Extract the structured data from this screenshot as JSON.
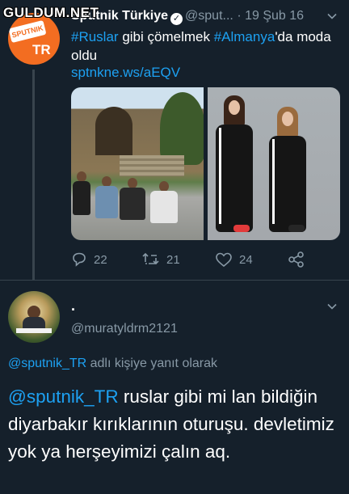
{
  "watermark": "GULDUM.NET",
  "tweet": {
    "author_name": "Sputnik Türkiye",
    "handle": "@sput...",
    "separator": "·",
    "date": "19 Şub 16",
    "avatar_text": "TR",
    "avatar_brand": "SPUTNIK",
    "text_parts": [
      {
        "type": "hashtag",
        "text": "#Ruslar"
      },
      {
        "type": "text",
        "text": " gibi çömelmek "
      },
      {
        "type": "hashtag",
        "text": "#Almanya"
      },
      {
        "type": "text",
        "text": "'da moda oldu"
      }
    ],
    "link": "sptnkne.ws/aEQV",
    "actions": {
      "reply_count": "22",
      "retweet_count": "21",
      "like_count": "24"
    },
    "icons": [
      "verified-icon",
      "chevron-down-icon",
      "reply-icon",
      "retweet-icon",
      "like-icon",
      "share-icon"
    ]
  },
  "reply": {
    "author_name": ".",
    "handle": "@muratyldrm2121",
    "replying_to_handle": "@sputnik_TR",
    "replying_to_suffix": " adlı kişiye yanıt olarak",
    "mention": "@sputnik_TR",
    "text": " ruslar gibi mi  lan bildiğin diyarbakır kırıklarının oturuşu. devletimiz yok ya herşeyimizi çalın aq."
  },
  "colors": {
    "background": "#15202b",
    "accent": "#1da1f2",
    "muted": "#8899a6",
    "divider": "#38444d",
    "brand": "#f36d21"
  }
}
